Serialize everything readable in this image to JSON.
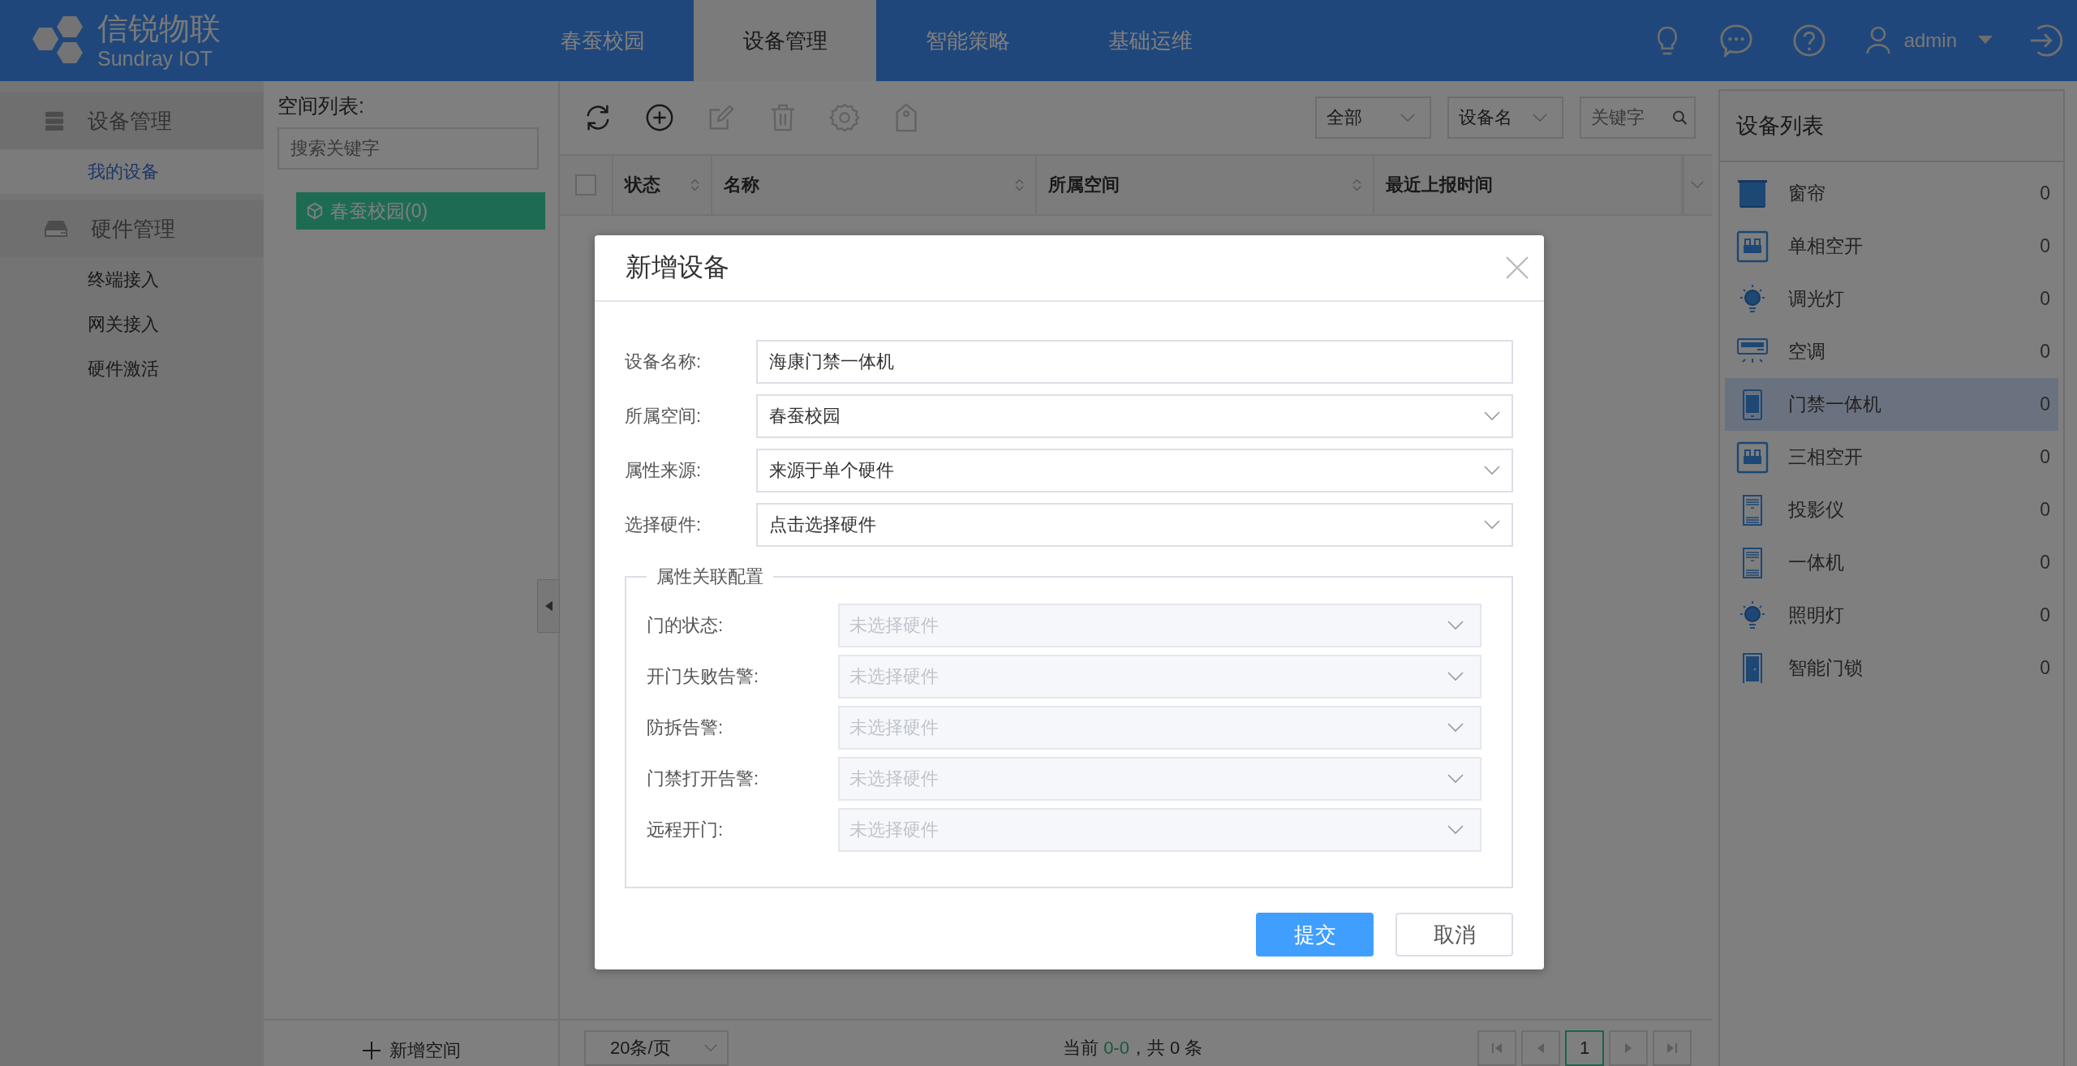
{
  "header": {
    "logo": {
      "title": "信锐物联",
      "subtitle": "Sundray IOT"
    },
    "nav": [
      {
        "label": "春蚕校园",
        "selected": false
      },
      {
        "label": "设备管理",
        "selected": true
      },
      {
        "label": "智能策略",
        "selected": false
      },
      {
        "label": "基础运维",
        "selected": false
      }
    ],
    "user": "admin"
  },
  "sidebar": {
    "groups": [
      {
        "label": "设备管理",
        "kind": "devices",
        "items": [
          {
            "label": "我的设备",
            "selected": true
          }
        ]
      },
      {
        "label": "硬件管理",
        "kind": "hardware",
        "items": [
          {
            "label": "终端接入",
            "selected": false
          },
          {
            "label": "网关接入",
            "selected": false
          },
          {
            "label": "硬件激活",
            "selected": false
          }
        ]
      }
    ]
  },
  "space_panel": {
    "title": "空间列表:",
    "search": {
      "placeholder": "搜索关键字"
    },
    "tree": [
      {
        "label": "春蚕校园(0)",
        "selected": true
      }
    ],
    "add_button": "新增空间"
  },
  "toolbar": {
    "tools": [
      {
        "kind": "refresh",
        "disabled": false
      },
      {
        "kind": "add",
        "disabled": false
      },
      {
        "kind": "edit",
        "disabled": true
      },
      {
        "kind": "delete",
        "disabled": true
      },
      {
        "kind": "settings",
        "disabled": true
      },
      {
        "kind": "tag",
        "disabled": true
      }
    ],
    "filters": [
      {
        "value": "全部"
      },
      {
        "value": "设备名"
      }
    ],
    "search": {
      "placeholder": "关键字"
    }
  },
  "table": {
    "select_all_checked": false,
    "columns": [
      {
        "label": "状态",
        "sortable": true
      },
      {
        "label": "名称",
        "sortable": true
      },
      {
        "label": "所属空间",
        "sortable": true
      },
      {
        "label": "最近上报时间",
        "sortable": false
      }
    ]
  },
  "pagination": {
    "page_size": "20条/页",
    "prefix": "当前",
    "range": "0-0",
    "suffix": "，共 0 条",
    "page": "1"
  },
  "device_list": {
    "title": "设备列表",
    "items": [
      {
        "label": "窗帘",
        "count": "0",
        "kind": "curtain",
        "selected": false
      },
      {
        "label": "单相空开",
        "count": "0",
        "kind": "breaker",
        "selected": false
      },
      {
        "label": "调光灯",
        "count": "0",
        "kind": "bulb",
        "selected": false
      },
      {
        "label": "空调",
        "count": "0",
        "kind": "aircon",
        "selected": false
      },
      {
        "label": "门禁一体机",
        "count": "0",
        "kind": "terminal",
        "selected": true
      },
      {
        "label": "三相空开",
        "count": "0",
        "kind": "breaker",
        "selected": false
      },
      {
        "label": "投影仪",
        "count": "0",
        "kind": "cabinet",
        "selected": false
      },
      {
        "label": "一体机",
        "count": "0",
        "kind": "cabinet",
        "selected": false
      },
      {
        "label": "照明灯",
        "count": "0",
        "kind": "bulb",
        "selected": false
      },
      {
        "label": "智能门锁",
        "count": "0",
        "kind": "door",
        "selected": false
      }
    ]
  },
  "dialog": {
    "title": "新增设备",
    "fields": [
      {
        "label": "设备名称:",
        "value": "海康门禁一体机",
        "kind": "input"
      },
      {
        "label": "所属空间:",
        "value": "春蚕校园",
        "kind": "select"
      },
      {
        "label": "属性来源:",
        "value": "来源于单个硬件",
        "kind": "select"
      },
      {
        "label": "选择硬件:",
        "value": "点击选择硬件",
        "kind": "select"
      }
    ],
    "fieldset": {
      "legend": "属性关联配置",
      "fields": [
        {
          "label": "门的状态:",
          "placeholder": "未选择硬件",
          "disabled": true
        },
        {
          "label": "开门失败告警:",
          "placeholder": "未选择硬件",
          "disabled": true
        },
        {
          "label": "防拆告警:",
          "placeholder": "未选择硬件",
          "disabled": true
        },
        {
          "label": "门禁打开告警:",
          "placeholder": "未选择硬件",
          "disabled": true
        },
        {
          "label": "远程开门:",
          "placeholder": "未选择硬件",
          "disabled": true
        }
      ]
    },
    "buttons": [
      {
        "label": "提交",
        "kind": "primary"
      },
      {
        "label": "取消",
        "kind": "default"
      }
    ]
  }
}
